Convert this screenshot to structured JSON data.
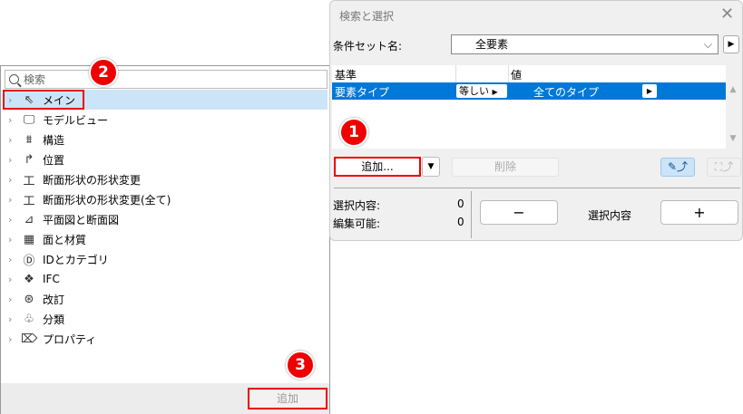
{
  "left_panel": {
    "search_placeholder": "検索",
    "items": [
      {
        "label": "メイン",
        "icon": "cursor-icon",
        "glyph": "⇖"
      },
      {
        "label": "モデルビュー",
        "icon": "monitor-icon",
        "glyph": "🖵"
      },
      {
        "label": "構造",
        "icon": "structure-icon",
        "glyph": "⩩"
      },
      {
        "label": "位置",
        "icon": "position-icon",
        "glyph": "↱"
      },
      {
        "label": "断面形状の形状変更",
        "icon": "beam-icon",
        "glyph": "工"
      },
      {
        "label": "断面形状の形状変更(全て)",
        "icon": "beam-icon",
        "glyph": "工"
      },
      {
        "label": "平面図と断面図",
        "icon": "plan-section-icon",
        "glyph": "⊿"
      },
      {
        "label": "面と材質",
        "icon": "material-icon",
        "glyph": "▦"
      },
      {
        "label": "IDとカテゴリ",
        "icon": "id-icon",
        "glyph": "Ⓓ"
      },
      {
        "label": "IFC",
        "icon": "ifc-icon",
        "glyph": "❖"
      },
      {
        "label": "改訂",
        "icon": "revision-icon",
        "glyph": "⊛"
      },
      {
        "label": "分類",
        "icon": "classification-icon",
        "glyph": "♧"
      },
      {
        "label": "プロパティ",
        "icon": "tag-icon",
        "glyph": "⌦"
      }
    ],
    "add_label": "追加"
  },
  "dialog": {
    "title": "検索と選択",
    "set_label": "条件セット名:",
    "set_value": "全要素",
    "table": {
      "headers": [
        "基準",
        "",
        "値"
      ],
      "row": {
        "criterion": "要素タイプ",
        "operator": "等しい",
        "value": "全てのタイプ"
      }
    },
    "add_label": "追加...",
    "delete_label": "削除",
    "selection_label": "選択内容:",
    "selection_count": "0",
    "editable_label": "編集可能:",
    "editable_count": "0",
    "minus": "−",
    "selection_center": "選択内容",
    "plus": "+"
  },
  "badges": [
    "1",
    "2",
    "3"
  ]
}
